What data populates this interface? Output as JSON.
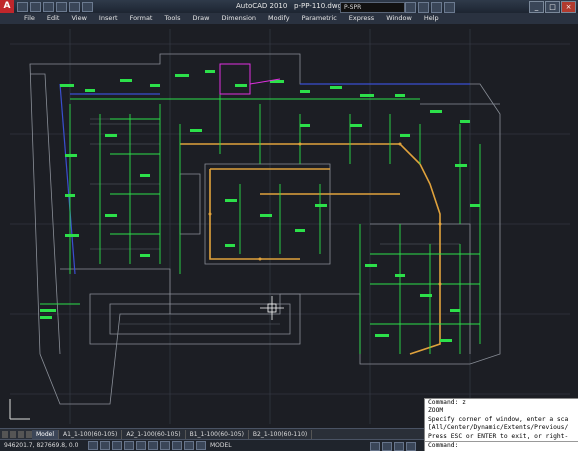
{
  "app": {
    "title": "AutoCAD 2010",
    "document": "p-PP-110.dwg",
    "logo": "A"
  },
  "toolbar": {
    "layer": "P-SPR",
    "window_buttons": [
      "_",
      "□",
      "×"
    ]
  },
  "menu": [
    "File",
    "Edit",
    "View",
    "Insert",
    "Format",
    "Tools",
    "Draw",
    "Dimension",
    "Modify",
    "Parametric",
    "Express",
    "Window",
    "Help"
  ],
  "tabs": {
    "model": "Model",
    "layouts": [
      "A1_1-100(60-105)",
      "A2_1-100(60-105)",
      "B1_1-100(60-105)",
      "B2_1-100(60-110)"
    ]
  },
  "status": {
    "coordinates": "946201.7, 827669.8, 0.0",
    "model_label": "MODEL"
  },
  "command_history": [
    "Command: z",
    "ZOOM",
    "Specify corner of window, enter a sca",
    "[All/Center/Dynamic/Extents/Previous/",
    "Press ESC or ENTER to exit, or right-"
  ],
  "command_prompt": "Command:",
  "colors": {
    "drawing_bg": "#1c1e24",
    "pipe_green": "#2ce04a",
    "pipe_orange": "#e0a23c",
    "wall_blue": "#3a4fd0",
    "magenta": "#e030e0"
  }
}
